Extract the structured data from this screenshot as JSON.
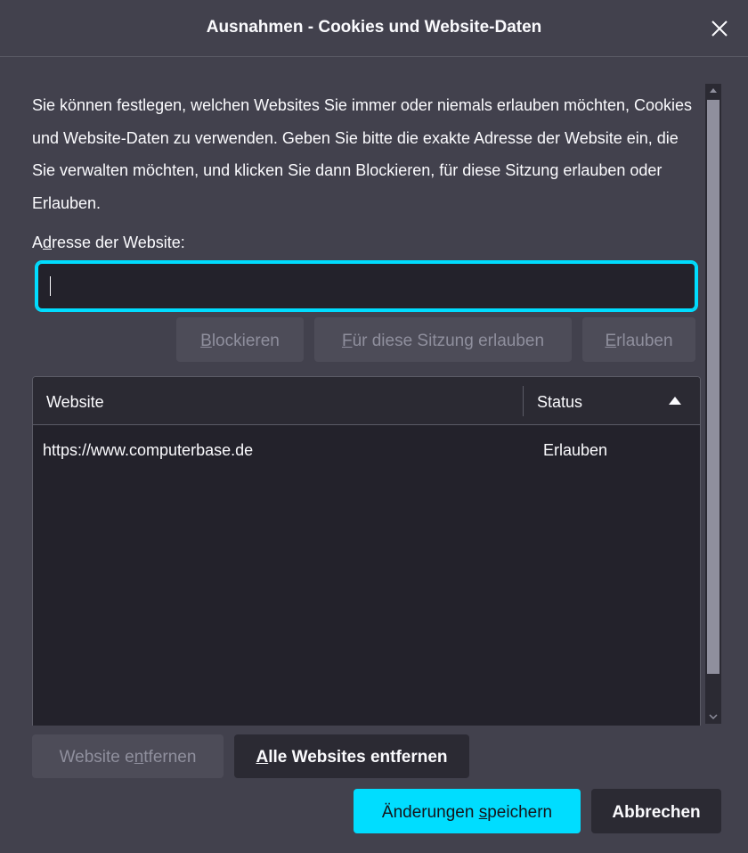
{
  "window": {
    "title": "Ausnahmen - Cookies und Website-Daten"
  },
  "description": "Sie können festlegen, welchen Websites Sie immer oder niemals erlauben möchten, Cookies und Website-Daten zu verwenden. Geben Sie bitte die exakte Adresse der Website ein, die Sie verwalten möchten, und klicken Sie dann Blockieren, für diese Sitzung erlauben oder Erlauben.",
  "address": {
    "label_a": "A",
    "label_d": "d",
    "label_rest": "resse der Website:",
    "value": ""
  },
  "buttons": {
    "block_u": "B",
    "block_rest": "lockieren",
    "session_u": "F",
    "session_rest": "ür diese Sitzung erlauben",
    "allow_u": "E",
    "allow_rest": "rlauben",
    "remove_pre": "Website e",
    "remove_u": "n",
    "remove_post": "tfernen",
    "remove_all_u": "A",
    "remove_all_rest": "lle Websites entfernen",
    "save_pre": "Änderungen ",
    "save_u": "s",
    "save_post": "peichern",
    "cancel": "Abbrechen"
  },
  "table": {
    "columns": {
      "website": "Website",
      "status": "Status"
    },
    "rows": [
      {
        "website": "https://www.computerbase.de",
        "status": "Erlauben"
      }
    ]
  },
  "colors": {
    "accent": "#00ddff",
    "dialog_bg": "#42414d",
    "field_bg": "#23222b"
  },
  "icons": {
    "close": "close-icon",
    "sort": "sort-ascending-icon"
  }
}
